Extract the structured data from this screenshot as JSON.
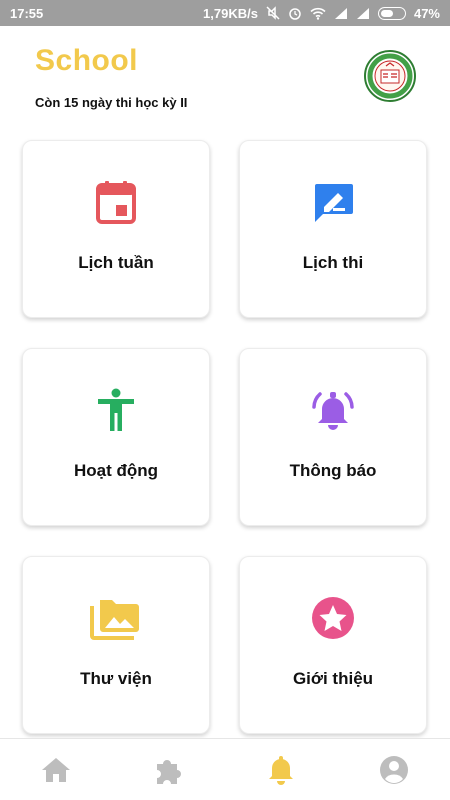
{
  "status_bar": {
    "time": "17:55",
    "network_speed": "1,79KB/s",
    "battery_percent": "47%",
    "battery_level": 0.47
  },
  "header": {
    "title": "School",
    "countdown": "Còn 15 ngày thi học kỳ II",
    "logo_icon": "school-logo"
  },
  "cards": [
    {
      "label": "Lịch tuần",
      "icon": "calendar-icon",
      "color": "#e5575c"
    },
    {
      "label": "Lịch thi",
      "icon": "edit-message-icon",
      "color": "#2f80ed"
    },
    {
      "label": "Hoạt động",
      "icon": "accessibility-icon",
      "color": "#27ae60"
    },
    {
      "label": "Thông báo",
      "icon": "bell-ring-icon",
      "color": "#9b5de5"
    },
    {
      "label": "Thư viện",
      "icon": "photo-library-icon",
      "color": "#f2c94c"
    },
    {
      "label": "Giới thiệu",
      "icon": "star-circle-icon",
      "color": "#e8538b"
    }
  ],
  "bottom_nav": {
    "items": [
      {
        "icon": "home-icon",
        "active": false
      },
      {
        "icon": "puzzle-icon",
        "active": false
      },
      {
        "icon": "bell-icon",
        "active": true
      },
      {
        "icon": "account-icon",
        "active": false
      }
    ],
    "active_color": "#f2c94c",
    "inactive_color": "#bdbdbd"
  }
}
